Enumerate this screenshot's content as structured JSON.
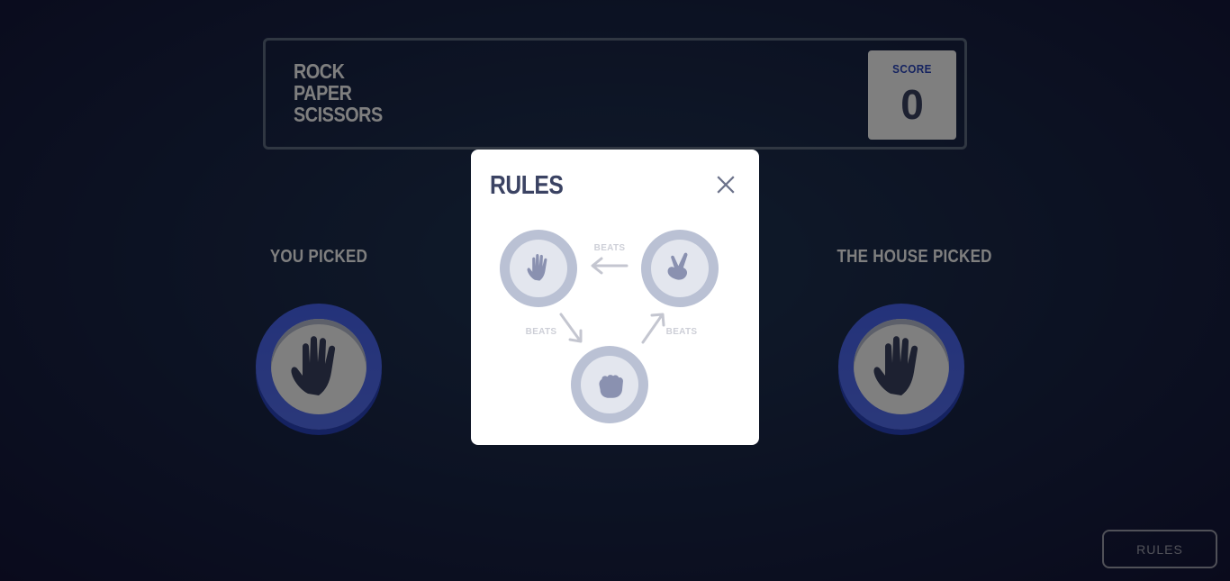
{
  "header": {
    "title_lines": [
      "ROCK",
      "PAPER",
      "SCISSORS"
    ],
    "score_label": "SCORE",
    "score_value": "0"
  },
  "game": {
    "you_picked_label": "YOU PICKED",
    "house_picked_label": "THE HOUSE PICKED",
    "player_choice_icon": "paper-hand-icon",
    "house_choice_icon": "paper-hand-icon"
  },
  "rules_button": {
    "label": "RULES"
  },
  "modal": {
    "title": "RULES",
    "close_icon": "close-icon",
    "diagram": {
      "beats_labels": [
        "BEATS",
        "BEATS",
        "BEATS"
      ],
      "icons": [
        "paper-hand-icon",
        "scissors-hand-icon",
        "rock-fist-icon"
      ]
    }
  },
  "colors": {
    "background_dark": "#141539",
    "background_light": "#1f3756",
    "header_outline": "#606e85",
    "score_text": "#2a46c0",
    "dark_text": "#3b4363",
    "paper_gradient": "#4865f4",
    "paper_shadow": "#2a45c2",
    "rules_token": "#bac1d4"
  }
}
